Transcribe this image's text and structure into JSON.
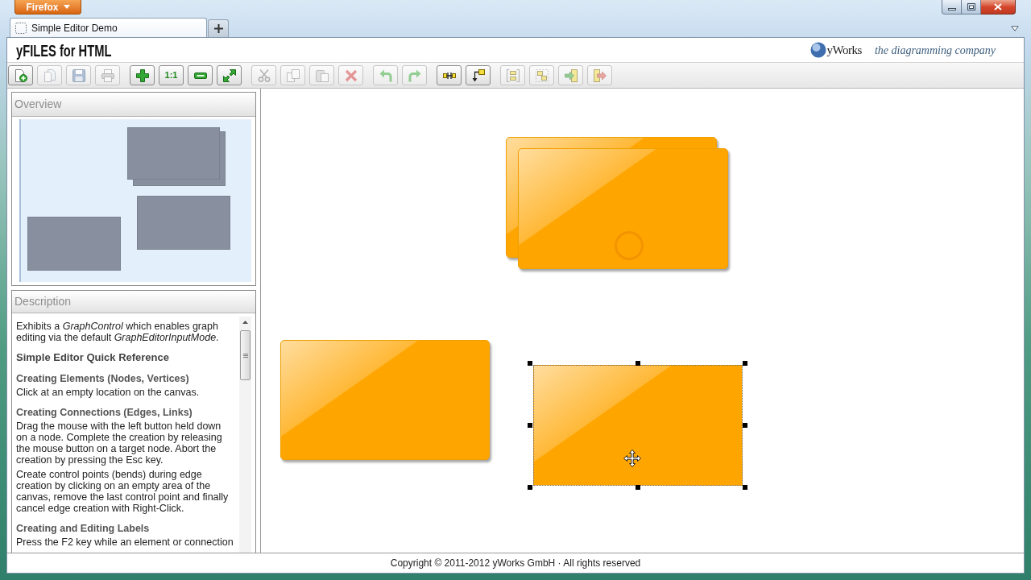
{
  "browser": {
    "menu_button": "Firefox",
    "tabs": [
      {
        "title": "Simple Editor Demo",
        "selected": true
      }
    ]
  },
  "app_header": {
    "title": "yFILES for HTML",
    "logo": "yWorks",
    "tagline": "the diagramming company"
  },
  "toolbar": {
    "groups": [
      [
        {
          "kind": "new",
          "disabled": false
        },
        {
          "kind": "open",
          "disabled": true
        },
        {
          "kind": "save",
          "disabled": true
        },
        {
          "kind": "print",
          "disabled": true
        }
      ],
      [
        {
          "kind": "zoomin",
          "disabled": false
        },
        {
          "kind": "actualsize",
          "label": "1:1",
          "disabled": false
        },
        {
          "kind": "zoomout",
          "disabled": false
        },
        {
          "kind": "fit",
          "disabled": false
        }
      ],
      [
        {
          "kind": "cut",
          "disabled": true
        },
        {
          "kind": "copy",
          "disabled": true
        },
        {
          "kind": "paste",
          "disabled": true
        },
        {
          "kind": "delete",
          "disabled": true
        }
      ],
      [
        {
          "kind": "undo",
          "disabled": true
        },
        {
          "kind": "redo",
          "disabled": true
        }
      ],
      [
        {
          "kind": "link",
          "disabled": false
        },
        {
          "kind": "bend",
          "disabled": false
        }
      ],
      [
        {
          "kind": "group",
          "disabled": true
        },
        {
          "kind": "ungroup",
          "disabled": true
        },
        {
          "kind": "enter",
          "disabled": true
        },
        {
          "kind": "exit",
          "disabled": true
        }
      ]
    ]
  },
  "overview": {
    "title": "Overview"
  },
  "description": {
    "title": "Description",
    "blocks": [
      {
        "kind": "paragraph",
        "text": "Exhibits a *GraphControl* which enables graph editing via the default *GraphEditorInputMode*."
      },
      {
        "kind": "title",
        "text": "Simple Editor Quick Reference"
      },
      {
        "kind": "heading",
        "text": "Creating Elements (Nodes, Vertices)"
      },
      {
        "kind": "paragraph",
        "text": "Click at an empty location on the canvas."
      },
      {
        "kind": "heading",
        "text": "Creating Connections (Edges, Links)"
      },
      {
        "kind": "paragraph",
        "text": "Drag the mouse with the left button held down on a node. Complete the creation by releasing the mouse button on a target node. Abort the creation by pressing the Esc key."
      },
      {
        "kind": "paragraph",
        "text": "Create control points (bends) during edge creation by clicking on an empty area of the canvas, remove the last control point and finally cancel edge creation with Right-Click."
      },
      {
        "kind": "heading",
        "text": "Creating and Editing Labels"
      },
      {
        "kind": "paragraph",
        "text": "Press the F2 key while an element or connection"
      }
    ]
  },
  "canvas": {
    "nodes": [
      {
        "selected": false
      },
      {
        "selected": false
      },
      {
        "selected": false
      },
      {
        "selected": true
      }
    ]
  },
  "footer": {
    "text": "Copyright © 2011-2012 yWorks GmbH · All rights reserved"
  }
}
